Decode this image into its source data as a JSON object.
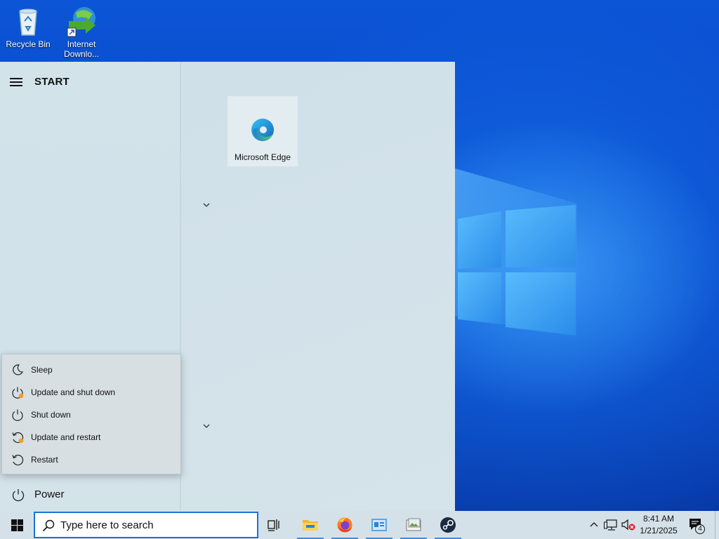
{
  "desktop": {
    "icons": [
      {
        "label": "Recycle Bin",
        "icon": "recycle-bin-icon"
      },
      {
        "label": "Internet Downlo...",
        "icon": "internet-download-manager-icon"
      }
    ]
  },
  "start_menu": {
    "title": "START",
    "tiles": [
      {
        "label": "Microsoft Edge",
        "icon": "edge-icon"
      }
    ],
    "power_menu": [
      {
        "label": "Sleep",
        "icon": "moon-icon"
      },
      {
        "label": "Update and shut down",
        "icon": "power-update-icon"
      },
      {
        "label": "Shut down",
        "icon": "power-icon"
      },
      {
        "label": "Update and restart",
        "icon": "restart-update-icon"
      },
      {
        "label": "Restart",
        "icon": "restart-icon"
      }
    ],
    "power_label": "Power"
  },
  "taskbar": {
    "search_placeholder": "Type here to search",
    "apps": [
      {
        "icon": "task-view-icon"
      },
      {
        "icon": "file-explorer-icon"
      },
      {
        "icon": "firefox-icon"
      },
      {
        "icon": "app-icon"
      },
      {
        "icon": "photo-viewer-icon"
      },
      {
        "icon": "steam-icon"
      }
    ],
    "clock_time": "8:41 AM",
    "clock_date": "1/21/2025",
    "notification_count": "4"
  },
  "colors": {
    "accent": "#1a73d9",
    "update_dot": "#f0a02b",
    "volume_muted": "#e81123"
  }
}
